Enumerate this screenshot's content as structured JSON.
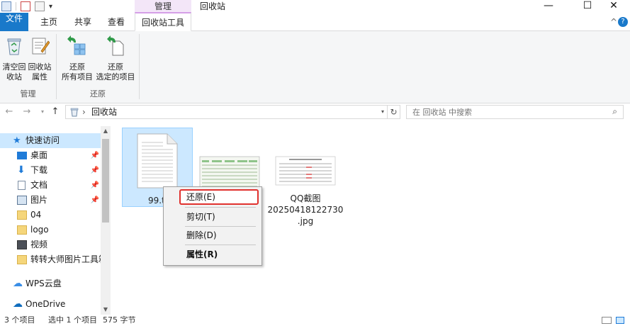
{
  "titlebar": {
    "context_tab": "管理",
    "title": "回收站",
    "minimize": "—",
    "maximize": "☐",
    "close": "✕"
  },
  "tabs": {
    "file": "文件",
    "home": "主页",
    "share": "共享",
    "view": "查看",
    "recycle_tools": "回收站工具",
    "collapse": "^",
    "help": "?"
  },
  "ribbon": {
    "empty_recycle_bin": [
      "清空回",
      "收站"
    ],
    "recycle_bin_properties": [
      "回收站",
      "属性"
    ],
    "restore_all": [
      "还原",
      "所有项目"
    ],
    "restore_selected": [
      "还原",
      "选定的项目"
    ],
    "group_manage": "管理",
    "group_restore": "还原"
  },
  "address": {
    "path": "回收站",
    "separator": "›",
    "search_placeholder": "在 回收站 中搜索"
  },
  "sidebar": {
    "quick_access": "快速访问",
    "items": [
      "桌面",
      "下载",
      "文档",
      "图片",
      "04",
      "logo",
      "视频",
      "转转大师图片工具箱"
    ],
    "wps": "WPS云盘",
    "onedrive": "OneDrive"
  },
  "files": [
    {
      "name": "99.tx"
    },
    {
      "name": ""
    },
    {
      "name": "QQ截图20250418122730.jpg",
      "lines": [
        "QQ截图",
        "20250418122730",
        ".jpg"
      ]
    }
  ],
  "context_menu": {
    "restore": "还原(E)",
    "cut": "剪切(T)",
    "delete": "删除(D)",
    "properties": "属性(R)"
  },
  "status": {
    "count": "3 个项目",
    "selected": "选中 1 个项目",
    "size": "575 字节"
  },
  "colors": {
    "file_tab": "#1979ca",
    "context_tab": "#f3e6f8",
    "selection": "#cce8ff",
    "highlight_box": "#e0312e"
  }
}
